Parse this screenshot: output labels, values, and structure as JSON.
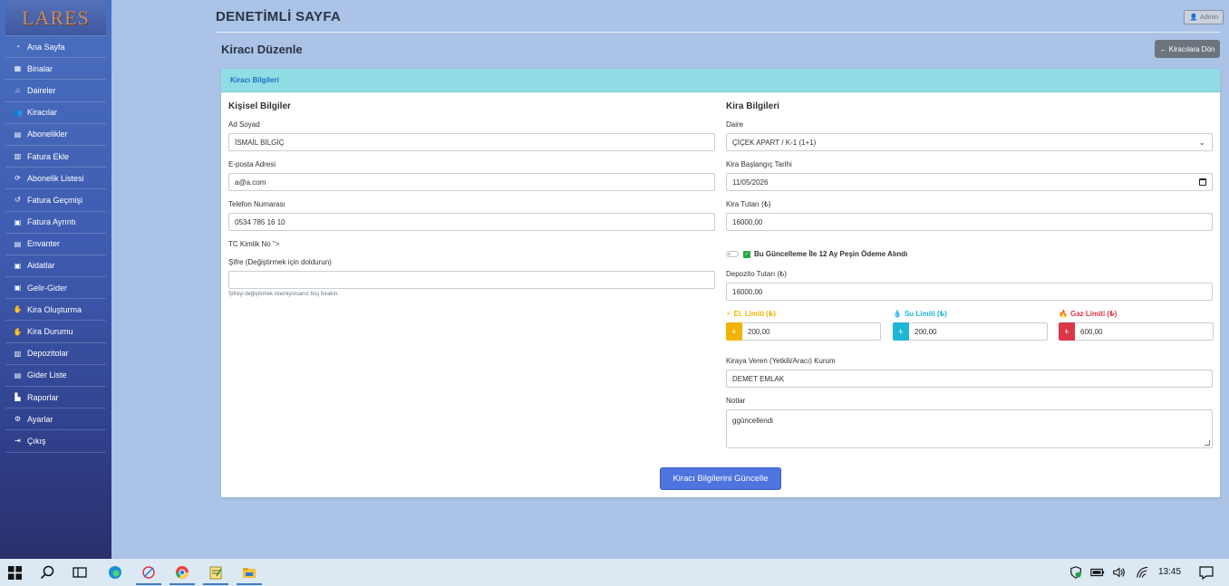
{
  "app": {
    "logo": "LARES",
    "page_heading": "DENETİMLİ SAYFA",
    "admin_label": "Admin"
  },
  "sidebar": {
    "items": [
      {
        "label": "Ana Sayfa",
        "icon": "◔",
        "name": "dashboard"
      },
      {
        "label": "Binalar",
        "icon": "▦",
        "name": "buildings"
      },
      {
        "label": "Daireler",
        "icon": "⌂",
        "name": "apartments"
      },
      {
        "label": "Kiracılar",
        "icon": "👥",
        "name": "tenants"
      },
      {
        "label": "Abonelikler",
        "icon": "▤",
        "name": "subscriptions"
      },
      {
        "label": "Fatura Ekle",
        "icon": "▥",
        "name": "add-invoice"
      },
      {
        "label": "Abonelik Listesi",
        "icon": "⟳",
        "name": "subscription-list"
      },
      {
        "label": "Fatura Geçmişi",
        "icon": "↺",
        "name": "invoice-history"
      },
      {
        "label": "Fatura Ayrıntı",
        "icon": "▣",
        "name": "invoice-details"
      },
      {
        "label": "Envanter",
        "icon": "▤",
        "name": "inventory"
      },
      {
        "label": "Aidatlar",
        "icon": "▣",
        "name": "dues"
      },
      {
        "label": "Gelir-Gider",
        "icon": "▣",
        "name": "income-expense"
      },
      {
        "label": "Kira Oluşturma",
        "icon": "✋",
        "name": "create-rent"
      },
      {
        "label": "Kira Durumu",
        "icon": "✋",
        "name": "rent-status"
      },
      {
        "label": "Depozitolar",
        "icon": "▥",
        "name": "deposits"
      },
      {
        "label": "Gider Liste",
        "icon": "▤",
        "name": "expense-list"
      },
      {
        "label": "Raporlar",
        "icon": "▙",
        "name": "reports"
      },
      {
        "label": "Ayarlar",
        "icon": "⚙",
        "name": "settings"
      },
      {
        "label": "Çıkış",
        "icon": "⇥",
        "name": "logout"
      }
    ]
  },
  "page": {
    "subtitle": "Kiracı Düzenle",
    "back_label": "Kiracılara Dön"
  },
  "card": {
    "header": "Kiracı Bilgileri"
  },
  "personal": {
    "title": "Kişisel Bilgiler",
    "name_label": "Ad Soyad",
    "name_value": "İSMAİL BİLGİÇ",
    "email_label": "E-posta Adresi",
    "email_value": "a@a.com",
    "phone_label": "Telefon Numarası",
    "phone_value": "0534 785 16 10",
    "tc_label": "TC Kimlik No \">",
    "password_label": "Şifre (Değiştirmek için doldurun)",
    "password_value": "",
    "password_help": "Şifreyi değiştirmek istemiyorsanız boş bırakın."
  },
  "rent": {
    "title": "Kira Bilgileri",
    "apartment_label": "Daire",
    "apartment_value": "ÇİÇEK APART / K-1 (1+1)",
    "start_label": "Kira Başlangıç Tarihi",
    "start_value": "11/05/2026",
    "amount_label": "Kira Tutarı (₺)",
    "amount_value": "16000,00",
    "prepay_label": "Bu Güncelleme İle 12 Ay Peşin Ödeme Alındı",
    "deposit_label": "Depozito Tutarı (₺)",
    "deposit_value": "16000,00",
    "limits": [
      {
        "label": "El. Limiti (₺)",
        "value": "200,00",
        "color": "#f0b400",
        "icon": "⚡",
        "name": "electricity"
      },
      {
        "label": "Su Limiti (₺)",
        "value": "200,00",
        "color": "#1fb6d6",
        "icon": "💧",
        "name": "water"
      },
      {
        "label": "Gaz Limiti (₺)",
        "value": "600,00",
        "color": "#dc3545",
        "icon": "🔥",
        "name": "gas"
      }
    ],
    "landlord_label": "Kiraya Veren (Yetkili/Aracı) Kurum",
    "landlord_value": "DEMET EMLAK",
    "notes_label": "Notlar",
    "notes_value": "ggüncellendi"
  },
  "submit_label": "Kiracı Bilgilerini Güncelle",
  "currency_symbol": "₺",
  "taskbar": {
    "clock": "13:45"
  }
}
